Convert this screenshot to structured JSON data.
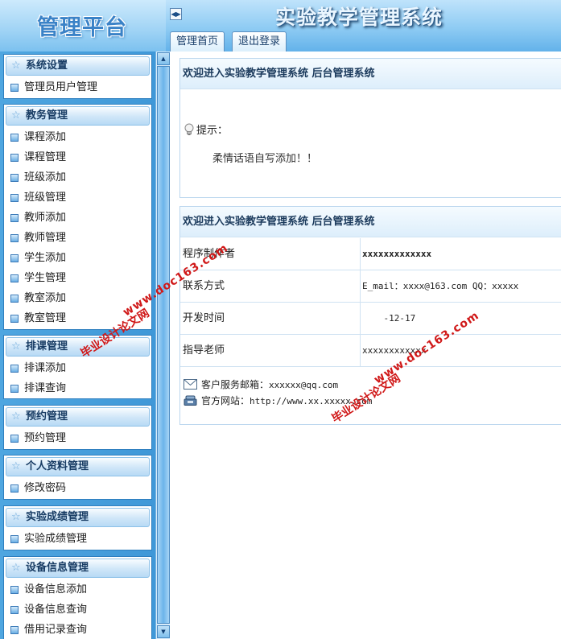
{
  "header": {
    "brand_title": "管理平台",
    "system_title": "实验教学管理系统",
    "tabs": [
      {
        "label": "管理首页"
      },
      {
        "label": "退出登录"
      }
    ]
  },
  "sidebar": {
    "groups": [
      {
        "title": "系统设置",
        "items": [
          "管理员用户管理"
        ]
      },
      {
        "title": "教务管理",
        "items": [
          "课程添加",
          "课程管理",
          "班级添加",
          "班级管理",
          "教师添加",
          "教师管理",
          "学生添加",
          "学生管理",
          "教室添加",
          "教室管理"
        ]
      },
      {
        "title": "排课管理",
        "items": [
          "排课添加",
          "排课查询"
        ]
      },
      {
        "title": "预约管理",
        "items": [
          "预约管理"
        ]
      },
      {
        "title": "个人资料管理",
        "items": [
          "修改密码"
        ]
      },
      {
        "title": "实验成绩管理",
        "items": [
          "实验成绩管理"
        ]
      },
      {
        "title": "设备信息管理",
        "items": [
          "设备信息添加",
          "设备信息查询",
          "借用记录查询"
        ]
      }
    ]
  },
  "main": {
    "welcome_panel": {
      "title": "欢迎进入实验教学管理系统 后台管理系统",
      "tip_label": "提示：",
      "tip_text": "柔情话语自写添加！！"
    },
    "info_panel": {
      "title": "欢迎进入实验教学管理系统 后台管理系统",
      "rows": [
        {
          "label": "程序制作者",
          "value": "xxxxxxxxxxxxx"
        },
        {
          "label": "联系方式",
          "value": "E_mail：xxxx@163.com QQ：xxxxx"
        },
        {
          "label": "开发时间",
          "value": "    -12-17"
        },
        {
          "label": "指导老师",
          "value": "xxxxxxxxxxxx"
        }
      ],
      "mail_label": "客户服务邮箱：",
      "mail_value": "xxxxxx@qq.com",
      "site_label": "官方网站：",
      "site_value": "http://www.xx.xxxxx.com"
    }
  },
  "watermarks": {
    "text_cn": "毕业设计论文网",
    "text_url": "www.doc163.com"
  }
}
